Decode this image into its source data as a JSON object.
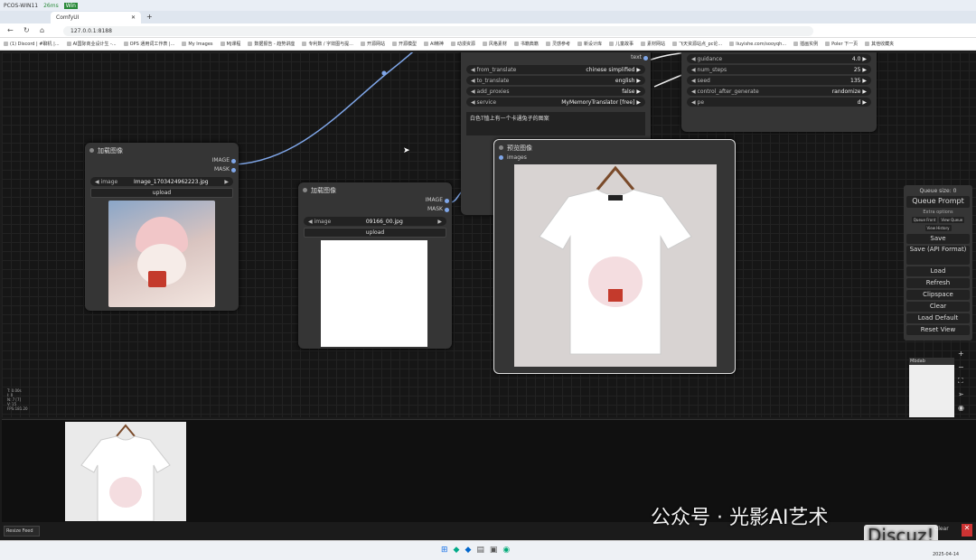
{
  "os": {
    "profile": "PCOS-WIN11",
    "latency": "26ms",
    "badge": "Win"
  },
  "browser": {
    "tab_title": "ComfyUI",
    "url": "127.0.0.1:8188",
    "bookmarks": [
      "(1) Discord | #聊机 |...",
      "AI国际商业设计生 -...",
      "OPS 通用词工作表 |...",
      "My Images",
      "MJ课程",
      "数据报告 - 趋势讲座",
      "专利数 / 字效图与提...",
      "开源网站",
      "开源模型",
      "AI精神",
      "动漫资源",
      "风格素材",
      "书籍典籍",
      "灵感参考",
      "新设计库",
      "儿童故事",
      "素材网站",
      "飞天资源站点_pc论...",
      "liuyishe.com/sooyqh...",
      "插画实例",
      "Poler 下一页",
      "其他收藏夹"
    ]
  },
  "nodes": {
    "load1": {
      "title": "加载图像",
      "out_image": "IMAGE",
      "out_mask": "MASK",
      "image_label": "image",
      "image_value": "Image_1703424962223.jpg",
      "upload": "upload"
    },
    "load2": {
      "title": "加载图像",
      "out_image": "IMAGE",
      "out_mask": "MASK",
      "image_label": "image",
      "image_value": "09166_00.jpg",
      "upload": "upload"
    },
    "preview": {
      "title": "预览图像",
      "input": "images"
    },
    "translator": {
      "text_label": "text",
      "widgets": [
        {
          "label": "from_translate",
          "value": "chinese simplified"
        },
        {
          "label": "to_translate",
          "value": "english"
        },
        {
          "label": "add_proxies",
          "value": "false"
        },
        {
          "label": "service",
          "value": "MyMemoryTranslator [free]"
        }
      ],
      "prompt_text": "白色T恤上有一个卡通兔子的图案"
    },
    "sampler": {
      "widgets": [
        {
          "label": "guidance",
          "value": "4.0"
        },
        {
          "label": "num_steps",
          "value": "25"
        },
        {
          "label": "seed",
          "value": "135"
        },
        {
          "label": "control_after_generate",
          "value": "randomize"
        },
        {
          "label": "pe",
          "value": "d"
        }
      ]
    }
  },
  "panel": {
    "queue_size": "Queue size: 0",
    "queue_prompt": "Queue Prompt",
    "extra_options": "Extra options",
    "small": [
      "Queue Front",
      "View Queue",
      "View History"
    ],
    "buttons": [
      "Save",
      "Save (API Format)",
      "Load",
      "Refresh",
      "Clipspace",
      "Clear",
      "Load Default",
      "Reset View"
    ],
    "minimap_label": "Mbdab"
  },
  "stats": [
    "T: 0.00s",
    "I: 0",
    "N: 7 [7]",
    "V: 15",
    "FPS:181.20"
  ],
  "footer": {
    "resize": "Resize Feed",
    "clear": "Clear"
  },
  "watermark": {
    "text": "公众号 · 光影AI艺术",
    "site": "Discuz!"
  },
  "taskbar": {
    "time": "2025-04-14"
  }
}
